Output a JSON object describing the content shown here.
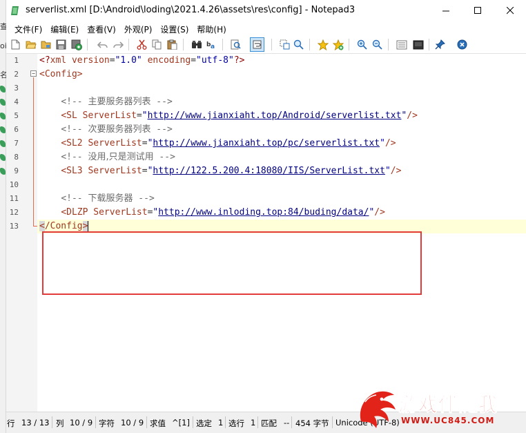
{
  "window": {
    "title": "serverlist.xml [D:\\Android\\loding\\2021.4.26\\assets\\res\\config] - Notepad3"
  },
  "background_app": {
    "glyphs": [
      "查",
      "oi",
      "名"
    ]
  },
  "menu": [
    {
      "label": "文件(F)"
    },
    {
      "label": "编辑(E)"
    },
    {
      "label": "查看(V)"
    },
    {
      "label": "外观(P)"
    },
    {
      "label": "设置(S)"
    },
    {
      "label": "帮助(H)"
    }
  ],
  "toolbar": {
    "icons": [
      "new-file-icon",
      "open-file-icon",
      "browse-icon",
      "save-icon",
      "save-as-icon",
      "undo-icon",
      "redo-icon",
      "cut-icon",
      "copy-icon",
      "paste-icon",
      "find-icon",
      "replace-icon",
      "find-in-page-icon",
      "word-wrap-icon",
      "zoom-icon",
      "zoom-find-icon",
      "favorite-icon",
      "add-favorite-icon",
      "zoom-in-icon",
      "zoom-out-icon",
      "settings-icon",
      "screen-icon",
      "pin-icon",
      "close-doc-icon"
    ]
  },
  "editor": {
    "line_numbers": [
      "1",
      "2",
      "3",
      "4",
      "5",
      "6",
      "7",
      "8",
      "9",
      "10",
      "11",
      "12",
      "13"
    ],
    "lines": {
      "l1": {
        "pi_open": "<?",
        "name": "xml",
        "a1": "version",
        "v1": "\"1.0\"",
        "a2": "encoding",
        "v2": "\"utf-8\"",
        "pi_close": "?>"
      },
      "l2": {
        "tag": "<Config>"
      },
      "l4": {
        "comment_open": "<!--",
        "text": "主要服务器列表",
        "comment_close": "-->"
      },
      "l5": {
        "tag_open": "<SL",
        "attr": "ServerList",
        "q": "\"",
        "url": "http://www.jianxiaht.top/Android/serverlist.txt",
        "tag_close": "/>"
      },
      "l6": {
        "comment_open": "<!--",
        "text": "次要服务器列表",
        "comment_close": "-->"
      },
      "l7": {
        "tag_open": "<SL2",
        "attr": "ServerList",
        "q": "\"",
        "url": "http://www.jianxiaht.top/pc/serverlist.txt",
        "tag_close": "/>"
      },
      "l8": {
        "comment_open": "<!--",
        "text": "没用,只是测试用",
        "comment_close": "-->"
      },
      "l9": {
        "tag_open": "<SL3",
        "attr": "ServerList",
        "q": "\"",
        "url": "http://122.5.200.4:18080/IIS/ServerList.txt",
        "tag_close": "/>"
      },
      "l11": {
        "comment_open": "<!--",
        "text": "下载服务器",
        "comment_close": "-->"
      },
      "l12": {
        "tag_open": "<DLZP",
        "attr": "ServerList",
        "q": "\"",
        "url": "http://www.inloding.top:84/buding/data/",
        "tag_close": "/>"
      },
      "l13": {
        "lt": "<",
        "slash_name": "/Config",
        "gt": ">"
      }
    },
    "fold_marker": "⊟"
  },
  "status": {
    "line_label": "行",
    "line_value": "13 / 13",
    "col_label": "列",
    "col_value": "10 / 9",
    "char_label": "字符",
    "char_value": "10 / 9",
    "eval_label": "求值",
    "eval_value": "^[1]",
    "sel_label": "选定",
    "sel_value": "1",
    "selline_label": "选行",
    "selline_value": "1",
    "match_label": "匹配",
    "match_value": "--",
    "bytes": "454 字节",
    "encoding": "Unicode (UTF-8)"
  },
  "watermark": {
    "title": "游戏伴随我",
    "url": "WWW.UC845.COM"
  },
  "colors": {
    "annotation_box": "#e23a3a",
    "current_line": "#ffffd8",
    "fold_line": "#e46a4e",
    "url": "#000080",
    "tag": "#a0371f"
  }
}
